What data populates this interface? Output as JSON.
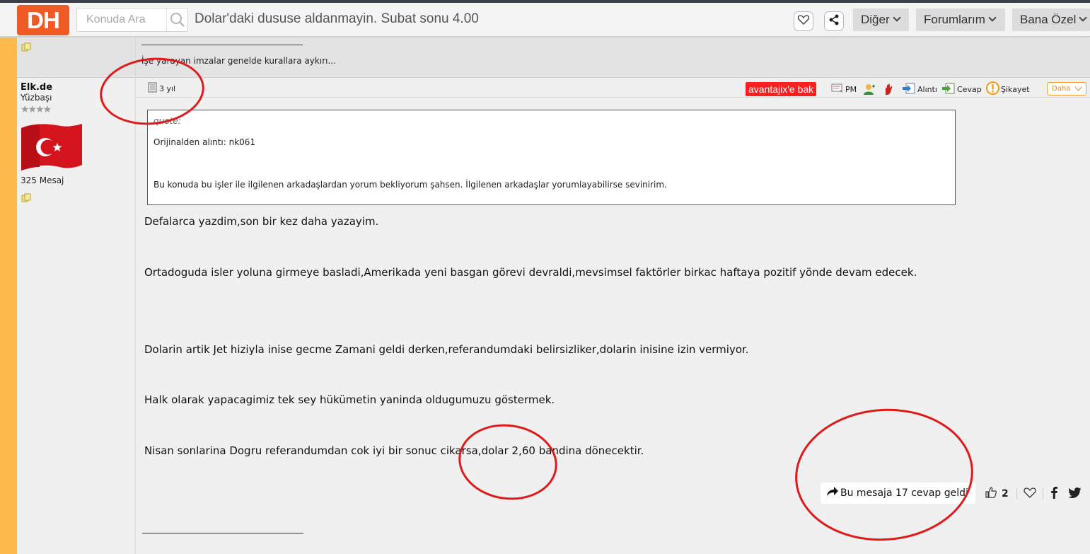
{
  "header": {
    "logo": "DH",
    "search_placeholder": "Konuda Ara",
    "page_title": "Dolar'daki dususe aldanmayin. Subat sonu 4.00",
    "menus": {
      "diger": "Diğer",
      "forumlarim": "Forumlarım",
      "bana_ozel": "Bana Özel"
    }
  },
  "signature": {
    "line": "______________________________",
    "text": "İşe yarayan imzalar genelde kurallara aykırı..."
  },
  "user": {
    "name": "Elk.de",
    "rank": "Yüzbaşı",
    "stars": "★★★★",
    "post_count": "325 Mesaj"
  },
  "post": {
    "age": "3 yıl",
    "ad_button": "avantajix'e bak",
    "actions": {
      "pm": "PM",
      "quote": "Alıntı",
      "reply": "Cevap",
      "report": "Şikayet",
      "more": "Daha"
    },
    "quote": {
      "header": "quote:",
      "original": "Orijinalden alıntı: nk061",
      "body": "Bu konuda bu işler ile ilgilenen arkadaşlardan yorum bekliyorum şahsen. İlgilenen arkadaşlar yorumlayabilirse sevinirim."
    },
    "paragraphs": [
      "Defalarca yazdim,son bir kez daha yazayim.",
      "Ortadoguda isler yoluna girmeye basladi,Amerikada yeni basgan görevi devraldi,mevsimsel faktörler birkac haftaya pozitif yönde devam edecek.",
      "Dolarin artik Jet hiziyla inise gecme Zamani geldi derken,referandumdaki belirsizliker,dolarin inisine izin vermiyor.",
      "Halk olarak yapacagimiz tek sey hükümetin yaninda oldugumuzu göstermek.",
      "Nisan sonlarina Dogru referandumdan cok iyi bir sonuc cikarsa,dolar 2,60 bandina dönecektir."
    ],
    "signature_line": "________________________",
    "replies_text": "Bu mesaja 17 cevap geldi",
    "like_count": "2"
  },
  "colors": {
    "accent": "#f05a25",
    "sidebar": "#fbb94c",
    "annotation": "#e01a1a",
    "ad": "#ff1f1f"
  }
}
